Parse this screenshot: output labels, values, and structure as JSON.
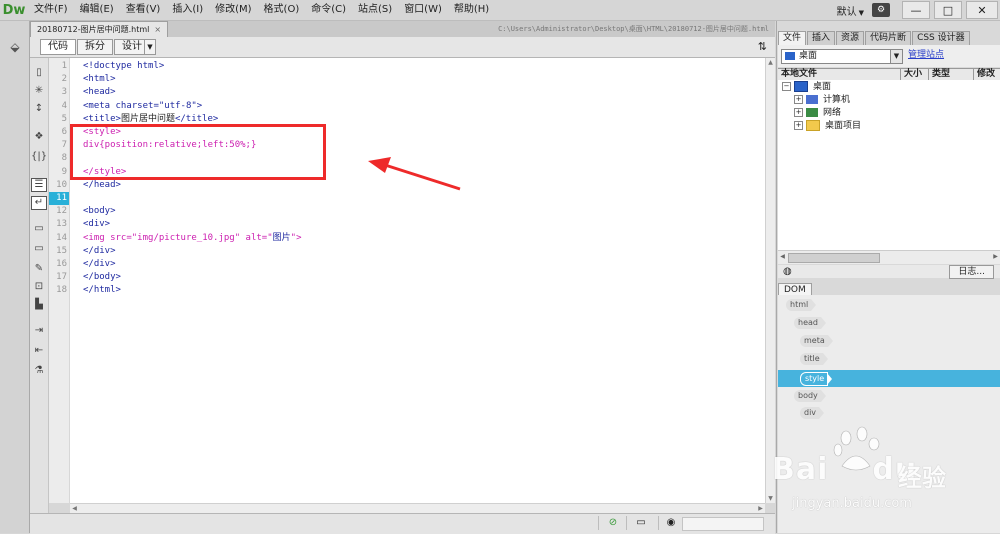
{
  "app": {
    "logo": "Dw",
    "menu": [
      "文件(F)",
      "编辑(E)",
      "查看(V)",
      "插入(I)",
      "修改(M)",
      "格式(O)",
      "命令(C)",
      "站点(S)",
      "窗口(W)",
      "帮助(H)"
    ],
    "preset": "默认",
    "window_buttons": {
      "min": "—",
      "max": "□",
      "close": "✕"
    }
  },
  "document": {
    "tab_label": "20180712-图片居中问题.html",
    "tab_close": "×",
    "path": "C:\\Users\\Administrator\\Desktop\\桌面\\HTML\\20180712-图片居中问题.html",
    "view_buttons": [
      "代码",
      "拆分",
      "设计"
    ],
    "current_line": "11",
    "line_numbers": [
      "1",
      "2",
      "3",
      "4",
      "5",
      "6",
      "7",
      "8",
      "9",
      "10",
      "11",
      "12",
      "13",
      "14",
      "15",
      "16",
      "17",
      "18"
    ],
    "lines": [
      {
        "parts": [
          {
            "t": "<!doctype html>",
            "c": "tag"
          }
        ]
      },
      {
        "parts": [
          {
            "t": "<html>",
            "c": "tag"
          }
        ]
      },
      {
        "parts": [
          {
            "t": "<head>",
            "c": "tag"
          }
        ]
      },
      {
        "parts": [
          {
            "t": "<meta charset=\"utf-8\">",
            "c": "tag"
          }
        ]
      },
      {
        "parts": [
          {
            "t": "<title>",
            "c": "tag"
          },
          {
            "t": "图片居中问题",
            "c": "dark"
          },
          {
            "t": "</title>",
            "c": "tag"
          }
        ]
      },
      {
        "parts": [
          {
            "t": "<style>",
            "c": "mag"
          }
        ]
      },
      {
        "parts": [
          {
            "t": "div{position:relative;left:50%;}",
            "c": "mag"
          }
        ]
      },
      {
        "parts": [
          {
            "t": "",
            "c": "tag"
          }
        ]
      },
      {
        "parts": [
          {
            "t": "</style>",
            "c": "mag"
          }
        ]
      },
      {
        "parts": [
          {
            "t": "</head>",
            "c": "tag"
          }
        ]
      },
      {
        "parts": [
          {
            "t": "",
            "c": "tag"
          }
        ]
      },
      {
        "parts": [
          {
            "t": "<body>",
            "c": "tag"
          }
        ]
      },
      {
        "parts": [
          {
            "t": "<div>",
            "c": "tag"
          }
        ]
      },
      {
        "parts": [
          {
            "t": "<img src=\"img/picture_10.jpg\" alt=\"",
            "c": "mag"
          },
          {
            "t": "图片",
            "c": "tag"
          },
          {
            "t": "\">",
            "c": "mag"
          }
        ]
      },
      {
        "parts": [
          {
            "t": "</div>",
            "c": "tag"
          }
        ]
      },
      {
        "parts": [
          {
            "t": "</div>",
            "c": "tag"
          }
        ]
      },
      {
        "parts": [
          {
            "t": "</body>",
            "c": "tag"
          }
        ]
      },
      {
        "parts": [
          {
            "t": "</html>",
            "c": "tag"
          }
        ]
      }
    ]
  },
  "files_panel": {
    "tabs": [
      "文件",
      "插入",
      "资源",
      "代码片断",
      "CSS 设计器"
    ],
    "site": "桌面",
    "manage_link": "管理站点",
    "columns": [
      "本地文件",
      "大小",
      "类型",
      "修改"
    ],
    "tree": [
      {
        "label": "桌面",
        "icon": "desktop-icon",
        "level": 0,
        "expander": "−"
      },
      {
        "label": "计算机",
        "icon": "computer-icon",
        "level": 1,
        "expander": "+"
      },
      {
        "label": "网络",
        "icon": "network-icon",
        "level": 1,
        "expander": "+"
      },
      {
        "label": "桌面项目",
        "icon": "folder-icon",
        "level": 1,
        "expander": "+"
      }
    ],
    "log_button": "日志..."
  },
  "dom_panel": {
    "tab": "DOM",
    "nodes": [
      "html",
      "head",
      "meta",
      "title",
      "style",
      "body",
      "div"
    ],
    "selected": "style"
  },
  "watermark": {
    "brand": "Bai",
    "brand2": "du",
    "cn": "经验",
    "url": "jingyan.baidu.com"
  },
  "colors": {
    "annotation": "#ee2a2a",
    "selection": "#47b3dd",
    "current_line": "#29b0d8",
    "tag": "#1f2aa0",
    "style_block": "#cc1fb0"
  }
}
